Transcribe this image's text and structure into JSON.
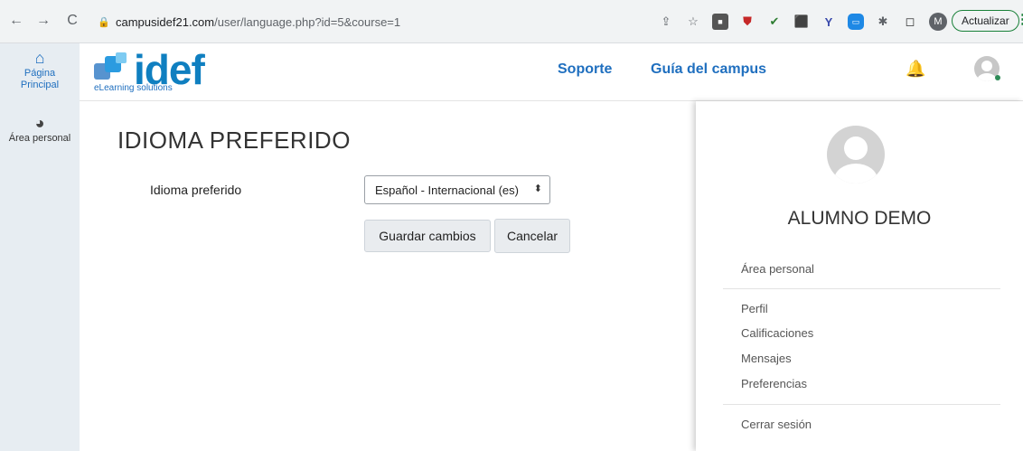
{
  "browser": {
    "url_host": "campusidef21.com",
    "url_path": "/user/language.php?id=5&course=1",
    "update_label": "Actualizar",
    "profile_initial": "M"
  },
  "rail": {
    "items": [
      {
        "icon": "home-icon",
        "label_line1": "Página",
        "label_line2": "Principal"
      },
      {
        "icon": "dashboard-icon",
        "label": "Área personal"
      }
    ]
  },
  "header": {
    "logo_word": "idef",
    "logo_sub": "eLearning solutions",
    "links": [
      "Soporte",
      "Guía del campus"
    ]
  },
  "main": {
    "title": "IDIOMA PREFERIDO",
    "field_label": "Idioma preferido",
    "select_value": "Español - Internacional (es)",
    "save_label": "Guardar cambios",
    "cancel_label": "Cancelar"
  },
  "drawer": {
    "user_name": "ALUMNO DEMO",
    "links": [
      "Área personal",
      "Perfil",
      "Calificaciones",
      "Mensajes",
      "Preferencias",
      "Cerrar sesión"
    ]
  },
  "colors": {
    "accent": "#1f6fbf",
    "rail_bg": "#e7edf2"
  }
}
